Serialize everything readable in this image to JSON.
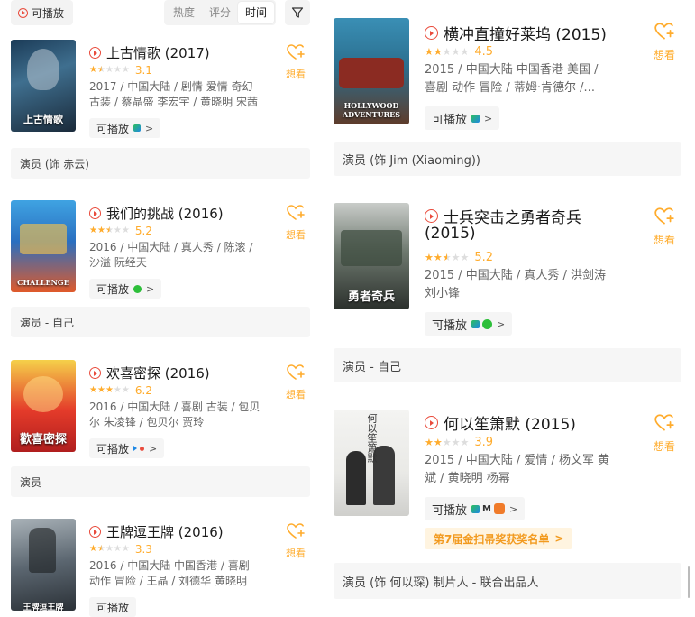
{
  "filters": {
    "playable_label": "可播放",
    "sort_options": [
      "热度",
      "评分",
      "时间"
    ],
    "active_sort": "时间"
  },
  "want_label": "想看",
  "play_label": "可播放",
  "left_items": [
    {
      "title": "上古情歌 (2017)",
      "rating": 3.1,
      "score": "3.1",
      "info_lines": [
        "2017 / 中国大陆 / 剧情 爱情 奇幻",
        "古装 / 蔡晶盛 李宏宇 / 黄晓明 宋茜"
      ],
      "poster_text": "上古情歌",
      "platforms": [
        "tencent"
      ],
      "role": "演员 (饰 赤云)"
    },
    {
      "title": "我们的挑战 (2016)",
      "rating": 5.2,
      "score": "5.2",
      "info_lines": [
        "2016 / 中国大陆 / 真人秀 / 陈滚 /",
        "沙溢 阮经天"
      ],
      "poster_text": "CHALLENGE",
      "platforms": [
        "iqiyi"
      ],
      "role": "演员 - 自己"
    },
    {
      "title": "欢喜密探 (2016)",
      "rating": 6.2,
      "score": "6.2",
      "info_lines": [
        "2016 / 中国大陆 / 喜剧 古装 / 包贝",
        "尔 朱凌锋 / 包贝尔 贾玲"
      ],
      "poster_text": "歡喜密探",
      "platforms": [
        "youku"
      ],
      "role": "演员"
    },
    {
      "title": "王牌逗王牌 (2016)",
      "rating": 3.3,
      "score": "3.3",
      "info_lines": [
        "2016 / 中国大陆 中国香港 / 喜剧",
        "动作 冒险 / 王晶 / 刘德华 黄晓明"
      ],
      "poster_text": "王牌逗王牌",
      "platforms": []
    }
  ],
  "right_items": [
    {
      "title": "横冲直撞好莱坞 (2015)",
      "rating": 4.5,
      "score": "4.5",
      "info_lines": [
        "2015 / 中国大陆 中国香港 美国 /",
        "喜剧 动作 冒险 / 蒂姆·肯德尔 /..."
      ],
      "poster_text": "HOLLYWOOD ADVENTURES",
      "platforms": [
        "tencent"
      ],
      "role": "演员 (饰 Jim (Xiaoming))"
    },
    {
      "title_line1": "士兵突击之勇者奇兵",
      "title_line2": "(2015)",
      "rating": 5.2,
      "score": "5.2",
      "info_lines": [
        "2015 / 中国大陆 / 真人秀 / 洪剑涛",
        "刘小锋"
      ],
      "poster_text": "勇者奇兵",
      "platforms": [
        "tencent",
        "iqiyi"
      ],
      "role": "演员 - 自己"
    },
    {
      "title": "何以笙箫默 (2015)",
      "rating": 3.9,
      "score": "3.9",
      "info_lines": [
        "2015 / 中国大陆 / 爱情 / 杨文军 黄",
        "斌 / 黄晓明 杨幂"
      ],
      "poster_text": "何以笙箫默",
      "platforms": [
        "tencent",
        "mgtv",
        "bilibili"
      ],
      "award": "第7届金扫帚奖获奖名单",
      "role": "演员 (饰 何以琛) 制片人 - 联合出品人"
    }
  ],
  "colors": {
    "accent": "#ffac2d",
    "play_red": "#e94b3c",
    "star_empty": "#dddddd"
  }
}
